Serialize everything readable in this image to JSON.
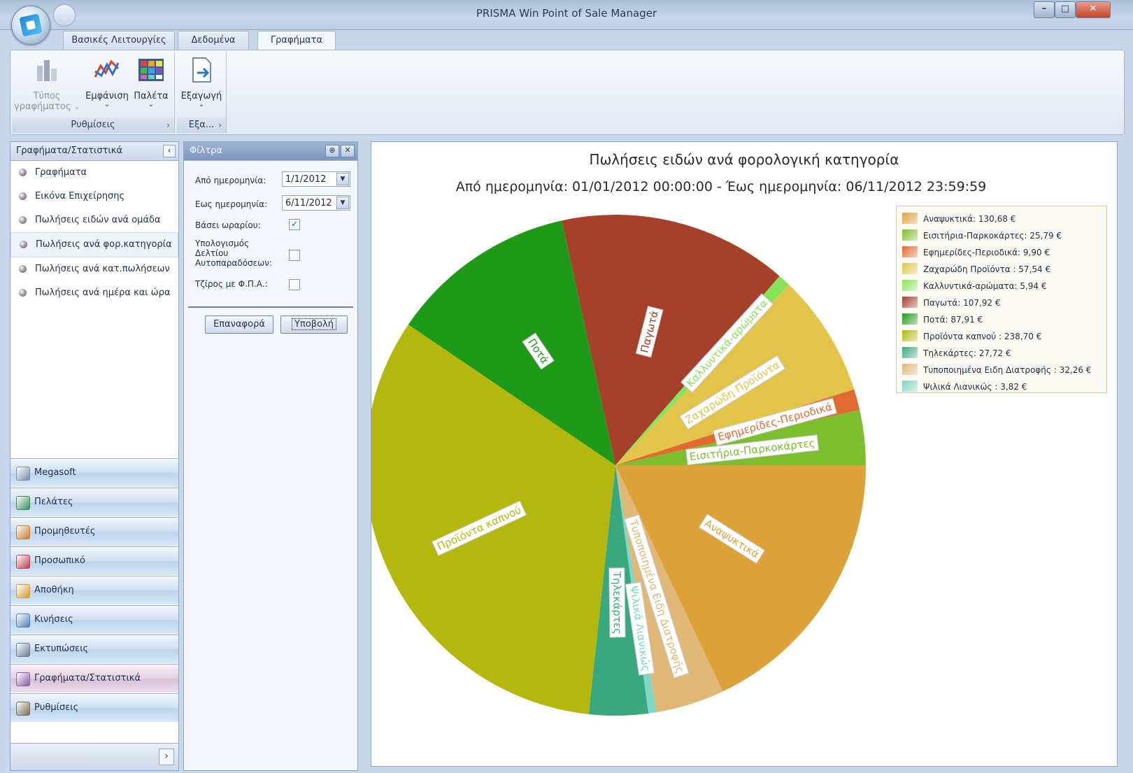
{
  "window": {
    "title": "PRISMA Win Point of Sale Manager"
  },
  "ribbon_tabs": [
    {
      "label": "Βασικές Λειτουργίες"
    },
    {
      "label": "Δεδομένα"
    },
    {
      "label": "Γραφήματα"
    }
  ],
  "ribbon": {
    "groups": [
      {
        "label": "Ρυθμίσεις"
      },
      {
        "label": "Εξα..."
      }
    ],
    "buttons": {
      "chart_type": {
        "label_line1": "Τύπος",
        "label_line2": "γραφήματος"
      },
      "appearance": {
        "label": "Εμφάνιση"
      },
      "palette": {
        "label": "Παλέτα"
      },
      "export": {
        "label": "Εξαγωγή"
      }
    }
  },
  "navigation": {
    "header": "Γραφήματα/Στατιστικά",
    "items": [
      {
        "label": "Γραφήματα"
      },
      {
        "label": "Εικόνα Επιχείρησης"
      },
      {
        "label": "Πωλήσεις ειδών ανά ομάδα"
      },
      {
        "label": "Πωλήσεις ανά φορ.κατηγορία"
      },
      {
        "label": "Πωλήσεις ανά κατ.πωλήσεων"
      },
      {
        "label": "Πωλήσεις ανά ημέρα και ώρα"
      }
    ],
    "modules": [
      {
        "label": "Megasoft",
        "icon": "megasoft-icon",
        "color": "#7a8ca6"
      },
      {
        "label": "Πελάτες",
        "icon": "customers-icon",
        "color": "#3c8c5a"
      },
      {
        "label": "Προμηθευτές",
        "icon": "suppliers-icon",
        "color": "#c77b2e"
      },
      {
        "label": "Προσωπικό",
        "icon": "staff-icon",
        "color": "#b8404a"
      },
      {
        "label": "Αποθήκη",
        "icon": "warehouse-icon",
        "color": "#d39b2a"
      },
      {
        "label": "Κινήσεις",
        "icon": "transactions-icon",
        "color": "#4f7fb8"
      },
      {
        "label": "Εκτυπώσεις",
        "icon": "printouts-icon",
        "color": "#6b7b94"
      },
      {
        "label": "Γραφήματα/Στατιστικά",
        "icon": "charts-icon",
        "color": "#8a5fa6"
      },
      {
        "label": "Ρυθμίσεις",
        "icon": "settings-icon",
        "color": "#7b6a52"
      }
    ]
  },
  "filters": {
    "header": "Φίλτρα",
    "from_date_label": "Από ημερομηνία:",
    "from_date_value": "1/1/2012",
    "to_date_label": "Εως ημερομηνία:",
    "to_date_value": "6/11/2012",
    "schedule_label": "Βάσει ωραρίου:",
    "schedule_checked": true,
    "calc_label_line1": "Υπολογισμός",
    "calc_label_line2": "Δελτίου",
    "calc_label_line3": "Αυτοπαραδόσεων:",
    "calc_checked": false,
    "vat_label": "Τζίρος με Φ.Π.Α.:",
    "vat_checked": false,
    "reset_label": "Επαναφορά",
    "submit_label": "Υποβολή"
  },
  "chart_data": {
    "type": "pie",
    "title": "Πωλήσεις ειδών ανά φορολογική κατηγορία",
    "subtitle": "Από ημερομηνία: 01/01/2012 00:00:00 - Έως ημερομηνία: 06/11/2012 23:59:59",
    "legend_position": "top-right",
    "currency": "€",
    "slices": [
      {
        "label": "Αναψυκτικά",
        "value": 130.68,
        "legend": "Αναψυκτικά: 130,68 €",
        "color": "#dea23a"
      },
      {
        "label": "Τυποποιημένα Ειδη Διατροφής",
        "value": 32.26,
        "legend": "Τυποποιημένα Ειδη Διατροφής : 32,26 €",
        "color": "#dfb878"
      },
      {
        "label": "Ψιλικά Λιανικώς",
        "value": 3.82,
        "legend": "Ψιλικά Λιανικώς : 3,82 €",
        "color": "#7fd6c4"
      },
      {
        "label": "Τηλεκάρτες",
        "value": 27.72,
        "legend": "Τηλεκάρτες: 27,72 €",
        "color": "#3aa87f"
      },
      {
        "label": "Προϊόντα καπνού",
        "value": 238.7,
        "legend": "Προϊόντα καπνού : 238,70 €",
        "color": "#b4b80e"
      },
      {
        "label": "Ποτά",
        "value": 87.91,
        "legend": "Ποτά: 87,91 €",
        "color": "#1f9a18"
      },
      {
        "label": "Παγωτά",
        "value": 107.92,
        "legend": "Παγωτά: 107,92 €",
        "color": "#a5402a"
      },
      {
        "label": "Καλλυντικά-αρώματα",
        "value": 5.94,
        "legend": "Καλλυντικά-αρώματα: 5,94 €",
        "color": "#86e45a"
      },
      {
        "label": "Ζαχαρώδη Προϊόντα",
        "value": 57.54,
        "legend": "Ζαχαρώδη Προϊόντα : 57,54 €",
        "color": "#e2c44a"
      },
      {
        "label": "Εφημερίδες-Περιοδικά",
        "value": 9.9,
        "legend": "Εφημερίδες-Περιοδικά: 9,90 €",
        "color": "#e06a32"
      },
      {
        "label": "Εισιτήρια-Παρκοκάρτες",
        "value": 25.79,
        "legend": "Εισιτήρια-Παρκοκάρτες: 25,79 €",
        "color": "#7cbf2e"
      }
    ],
    "legend_order": [
      "Αναψυκτικά",
      "Εισιτήρια-Παρκοκάρτες",
      "Εφημερίδες-Περιοδικά",
      "Ζαχαρώδη Προϊόντα",
      "Καλλυντικά-αρώματα",
      "Παγωτά",
      "Ποτά",
      "Προϊόντα καπνού",
      "Τηλεκάρτες",
      "Τυποποιημένα Ειδη Διατροφής",
      "Ψιλικά Λιανικώς"
    ]
  }
}
